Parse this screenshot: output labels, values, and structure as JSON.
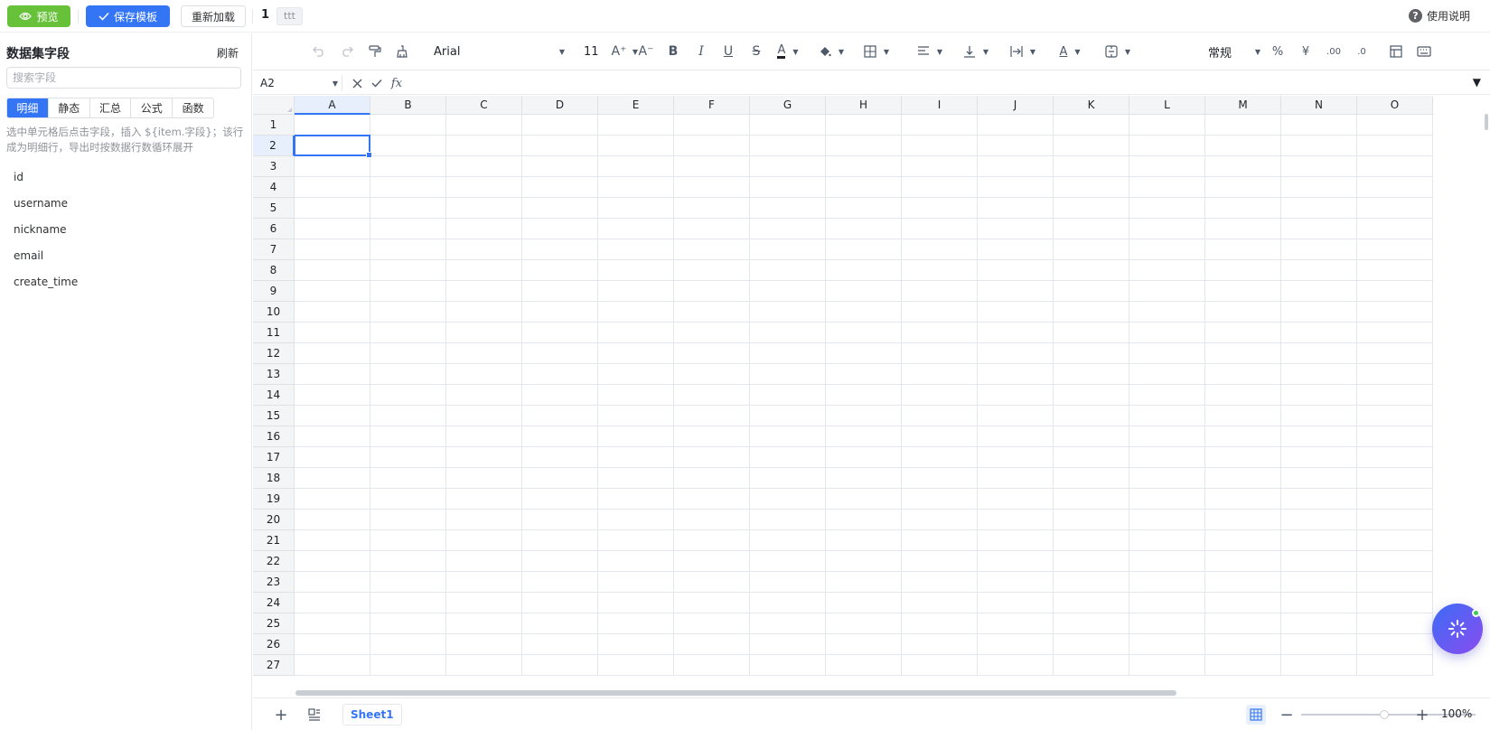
{
  "topbar": {
    "preview_label": "预览",
    "save_label": "保存模板",
    "reload_label": "重新加载",
    "template_no": "1",
    "template_tag": "ttt",
    "help_label": "使用说明"
  },
  "sidebar": {
    "title": "数据集字段",
    "refresh_label": "刷新",
    "search_placeholder": "搜索字段",
    "tabs": [
      "明细",
      "静态",
      "汇总",
      "公式",
      "函数"
    ],
    "active_tab": "明细",
    "hint": "选中单元格后点击字段，插入 ${item.字段}；该行成为明细行，导出时按数据行数循环展开",
    "fields": [
      "id",
      "username",
      "nickname",
      "email",
      "create_time"
    ]
  },
  "toolbar": {
    "font_family": "Arial",
    "font_size": "11",
    "number_format": "常规",
    "bold": "B",
    "italic": "I",
    "underline": "U",
    "strike": "S",
    "font_color_glyph": "A",
    "percent": "%",
    "currency": "¥"
  },
  "formula_bar": {
    "cell_ref": "A2",
    "fx": "fx",
    "value": ""
  },
  "sheet": {
    "columns": [
      "A",
      "B",
      "C",
      "D",
      "E",
      "F",
      "G",
      "H",
      "I",
      "J",
      "K",
      "L",
      "M",
      "N",
      "O"
    ],
    "rows": [
      "1",
      "2",
      "3",
      "4",
      "5",
      "6",
      "7",
      "8",
      "9",
      "10",
      "11",
      "12",
      "13",
      "14",
      "15",
      "16",
      "17",
      "18",
      "19",
      "20",
      "21",
      "22",
      "23",
      "24",
      "25",
      "26",
      "27"
    ],
    "selected_column": "A",
    "selected_row": "2"
  },
  "bottombar": {
    "sheet_name": "Sheet1",
    "zoom": "100%"
  },
  "colors": {
    "accent": "#3475f5",
    "success": "#67c23a",
    "header_bg": "#f4f5f7",
    "grid_line": "#e4e7ed"
  }
}
